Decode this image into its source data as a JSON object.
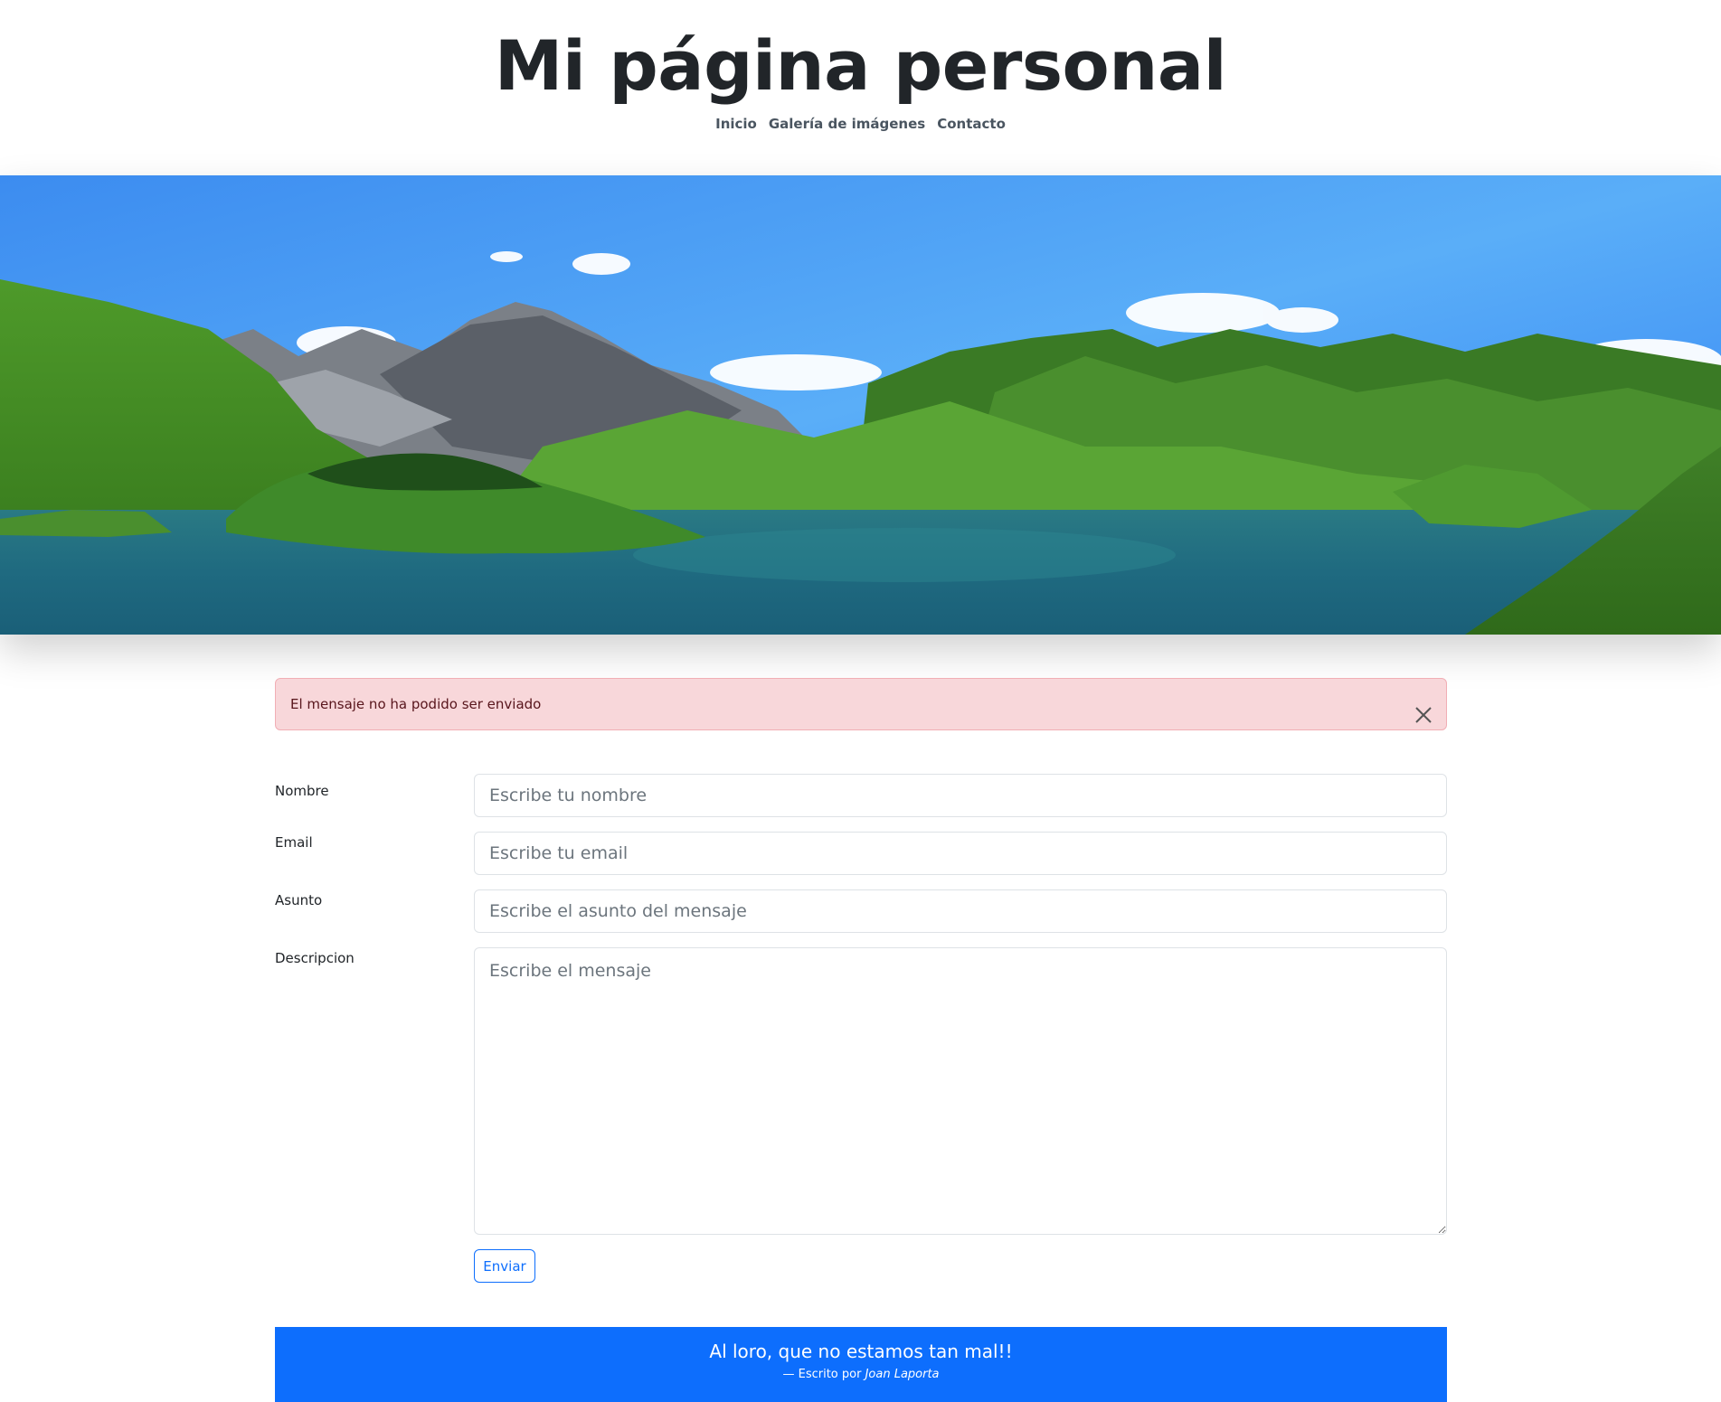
{
  "header": {
    "title": "Mi página personal",
    "nav": [
      {
        "label": "Inicio"
      },
      {
        "label": "Galería de imágenes"
      },
      {
        "label": "Contacto"
      }
    ]
  },
  "hero": {
    "image": "mountain-lake-landscape"
  },
  "alert": {
    "message": "El mensaje no ha podido ser enviado",
    "close_icon": "close-icon",
    "color": "#f8d7da"
  },
  "form": {
    "fields": [
      {
        "label": "Nombre",
        "placeholder": "Escribe tu nombre",
        "value": ""
      },
      {
        "label": "Email",
        "placeholder": "Escribe tu email",
        "value": ""
      },
      {
        "label": "Asunto",
        "placeholder": "Escribe el asunto del mensaje",
        "value": ""
      },
      {
        "label": "Descripcion",
        "placeholder": "Escribe el mensaje",
        "value": ""
      }
    ],
    "submit_label": "Enviar"
  },
  "footer": {
    "quote": "Al loro, que no estamos tan mal!!",
    "attribution_prefix": "— Escrito por",
    "author": "Joan Laporta",
    "color": "#0d6efd"
  }
}
